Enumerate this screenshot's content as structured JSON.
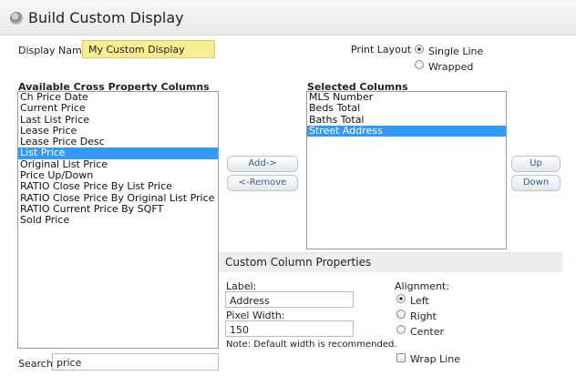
{
  "header": {
    "title": "Build Custom Display",
    "icon": "gear-icon"
  },
  "display_name": {
    "label": "Display Name",
    "value": "My Custom Display"
  },
  "print_layout": {
    "label": "Print Layout",
    "options": [
      {
        "label": "Single Line",
        "selected": true
      },
      {
        "label": "Wrapped",
        "selected": false
      }
    ]
  },
  "available": {
    "heading": "Available Cross Property Columns",
    "items": [
      "Ch Price Date",
      "Current Price",
      "Last List Price",
      "Lease Price",
      "Lease Price Desc",
      "List Price",
      "Original List Price",
      "Price Up/Down",
      "RATIO Close Price By List Price",
      "RATIO Close Price By Original List Price",
      "RATIO Current Price By SQFT",
      "Sold Price"
    ],
    "selected_index": 5
  },
  "selected": {
    "heading": "Selected Columns",
    "items": [
      "MLS Number",
      "Beds Total",
      "Baths Total",
      "Street Address"
    ],
    "selected_index": 3
  },
  "buttons": {
    "add": "Add->",
    "remove": "<-Remove",
    "up": "Up",
    "down": "Down"
  },
  "properties": {
    "title": "Custom Column Properties",
    "label_label": "Label:",
    "label_value": "Address",
    "width_label": "Pixel Width:",
    "width_value": "150",
    "note": "Note: Default width is recommended.",
    "alignment_label": "Alignment:",
    "alignment_options": [
      {
        "label": "Left",
        "selected": true
      },
      {
        "label": "Right",
        "selected": false
      },
      {
        "label": "Center",
        "selected": false
      }
    ],
    "wrap_label": "Wrap Line",
    "wrap_checked": false
  },
  "search": {
    "label": "Search:",
    "value": "price"
  },
  "colors": {
    "selection": "#3399ff",
    "name_field": "#f5ee93",
    "button_text": "#3a5a86"
  }
}
